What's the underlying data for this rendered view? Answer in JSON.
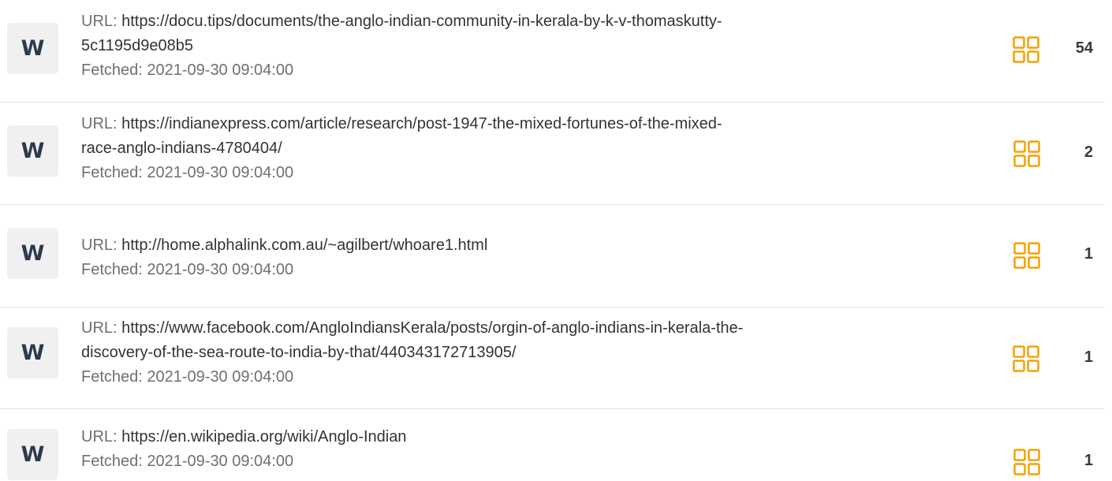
{
  "accent_color": "#f5a100",
  "badge_letter": "W",
  "sources": [
    {
      "url_prefix": "URL: ",
      "url_line1": "https://docu.tips/documents/the-anglo-indian-community-in-kerala-by-k-v-thomaskutty-",
      "url_line2": "5c1195d9e08b5",
      "fetched": "Fetched: 2021-09-30 09:04:00",
      "count": "54",
      "icon": "grid-icon"
    },
    {
      "url_prefix": "URL: ",
      "url_line1": "https://indianexpress.com/article/research/post-1947-the-mixed-fortunes-of-the-mixed-",
      "url_line2": "race-anglo-indians-4780404/",
      "fetched": "Fetched: 2021-09-30 09:04:00",
      "count": "2",
      "icon": "grid-icon"
    },
    {
      "url_prefix": "URL: ",
      "url_line1": "http://home.alphalink.com.au/~agilbert/whoare1.html",
      "url_line2": "",
      "fetched": "Fetched: 2021-09-30 09:04:00",
      "count": "1",
      "icon": "grid-icon"
    },
    {
      "url_prefix": "URL: ",
      "url_line1": "https://www.facebook.com/AngloIndiansKerala/posts/orgin-of-anglo-indians-in-kerala-the-",
      "url_line2": "discovery-of-the-sea-route-to-india-by-that/440343172713905/",
      "fetched": "Fetched: 2021-09-30 09:04:00",
      "count": "1",
      "icon": "grid-icon"
    },
    {
      "url_prefix": "URL: ",
      "url_line1": "https://en.wikipedia.org/wiki/Anglo-Indian",
      "url_line2": "",
      "fetched": "Fetched: 2021-09-30 09:04:00",
      "count": "1",
      "icon": "grid-icon"
    }
  ]
}
